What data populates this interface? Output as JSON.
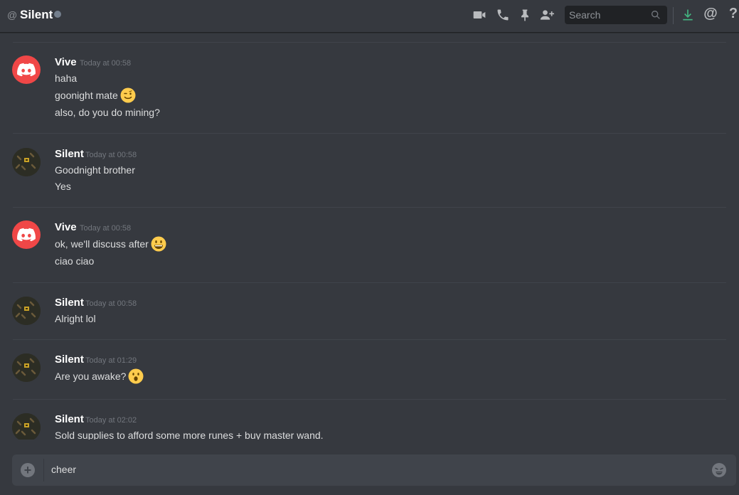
{
  "header": {
    "at_symbol": "@",
    "title": "Silent",
    "search_placeholder": "Search",
    "mention_symbol": "@",
    "help_symbol": "?"
  },
  "messages": [
    {
      "author": "Vive",
      "timestamp": "Today at 00:58",
      "avatar": "discord-logo",
      "lines": [
        "haha",
        "goonight mate",
        "also, do you do mining?"
      ]
    },
    {
      "author": "Silent",
      "timestamp": "Today at 00:58",
      "avatar": "user-avatar",
      "lines": [
        "Goodnight brother",
        "Yes"
      ]
    },
    {
      "author": "Vive",
      "timestamp": "Today at 00:58",
      "avatar": "discord-logo",
      "lines": [
        "ok, we'll discuss after",
        "ciao ciao"
      ]
    },
    {
      "author": "Silent",
      "timestamp": "Today at 00:58",
      "avatar": "user-avatar",
      "lines": [
        "Alright lol"
      ]
    },
    {
      "author": "Silent",
      "timestamp": "Today at 01:29",
      "avatar": "user-avatar",
      "lines": [
        "Are you awake?"
      ]
    },
    {
      "author": "Silent",
      "timestamp": "Today at 02:02",
      "avatar": "user-avatar",
      "lines": [
        "Sold supplies to afford some more runes + buy master wand."
      ]
    }
  ],
  "composer": {
    "upload_symbol": "+",
    "text": "cheer"
  },
  "colors": {
    "background": "#36393f",
    "input_bg": "#40444b",
    "discord_red": "#f04747",
    "download_green": "#43b581",
    "emoji_yellow": "#ffcc4d"
  }
}
